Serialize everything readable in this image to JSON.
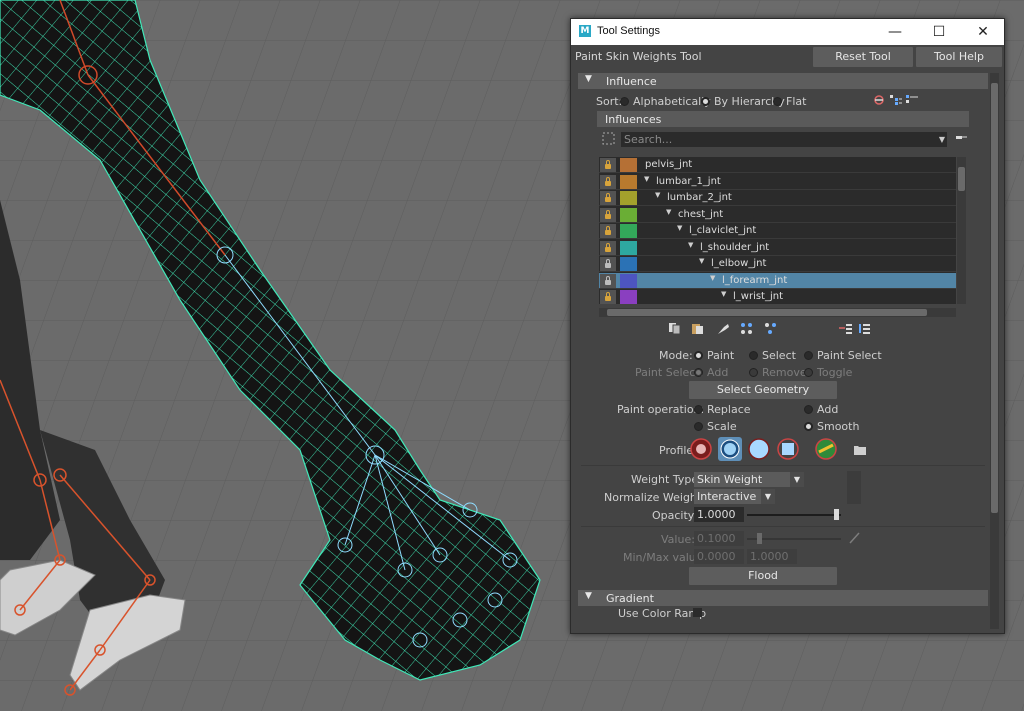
{
  "window": {
    "title": "Tool Settings",
    "logo": "M",
    "minimize": "—",
    "maximize": "☐",
    "close": "✕"
  },
  "tool": {
    "name": "Paint Skin Weights Tool",
    "reset": "Reset Tool",
    "help": "Tool Help"
  },
  "influence_section": {
    "title": "Influence",
    "sort_label": "Sort:",
    "sort_options": [
      "Alphabetically",
      "By Hierarchy",
      "Flat"
    ],
    "sort_selected": "By Hierarchy",
    "influences_header": "Influences",
    "search_placeholder": "Search..."
  },
  "influences": [
    {
      "name": "pelvis_jnt",
      "color": "#b57035",
      "locked": true,
      "expanded": false
    },
    {
      "name": "lumbar_1_jnt",
      "color": "#b87a2e",
      "locked": true,
      "expanded": true
    },
    {
      "name": "lumbar_2_jnt",
      "color": "#a3a12c",
      "locked": true,
      "expanded": true
    },
    {
      "name": "chest_jnt",
      "color": "#6aae35",
      "locked": true,
      "expanded": true
    },
    {
      "name": "l_claviclet_jnt",
      "color": "#33a85a",
      "locked": true,
      "expanded": true
    },
    {
      "name": "l_shoulder_jnt",
      "color": "#2ea8a0",
      "locked": true,
      "expanded": true
    },
    {
      "name": "l_elbow_jnt",
      "color": "#2b72b5",
      "locked": false,
      "expanded": true
    },
    {
      "name": "l_forearm_jnt",
      "color": "#4d55c0",
      "locked": false,
      "expanded": true,
      "selected": true
    },
    {
      "name": "l_wrist_jnt",
      "color": "#8a3fc0",
      "locked": true,
      "expanded": true
    }
  ],
  "mode": {
    "label": "Mode:",
    "options": [
      "Paint",
      "Select",
      "Paint Select"
    ],
    "selected": "Paint",
    "paint_select_label": "Paint Select:",
    "paint_select_options": [
      "Add",
      "Remove",
      "Toggle"
    ],
    "select_geometry": "Select Geometry"
  },
  "paint_operation": {
    "label": "Paint operation:",
    "options": [
      "Replace",
      "Add",
      "Scale",
      "Smooth"
    ],
    "selected": "Smooth"
  },
  "profile": {
    "label": "Profile:"
  },
  "weight_type": {
    "label": "Weight Type:",
    "value": "Skin Weight"
  },
  "normalize": {
    "label": "Normalize Weights:",
    "value": "Interactive"
  },
  "opacity": {
    "label": "Opacity:",
    "value": "1.0000",
    "level": 1.0
  },
  "value": {
    "label": "Value:",
    "value": "0.1000",
    "level": 0.1
  },
  "minmax": {
    "label": "Min/Max value:",
    "min": "0.0000",
    "max": "1.0000"
  },
  "flood": "Flood",
  "gradient": {
    "title": "Gradient",
    "use_color_ramp": "Use Color Ramp"
  }
}
